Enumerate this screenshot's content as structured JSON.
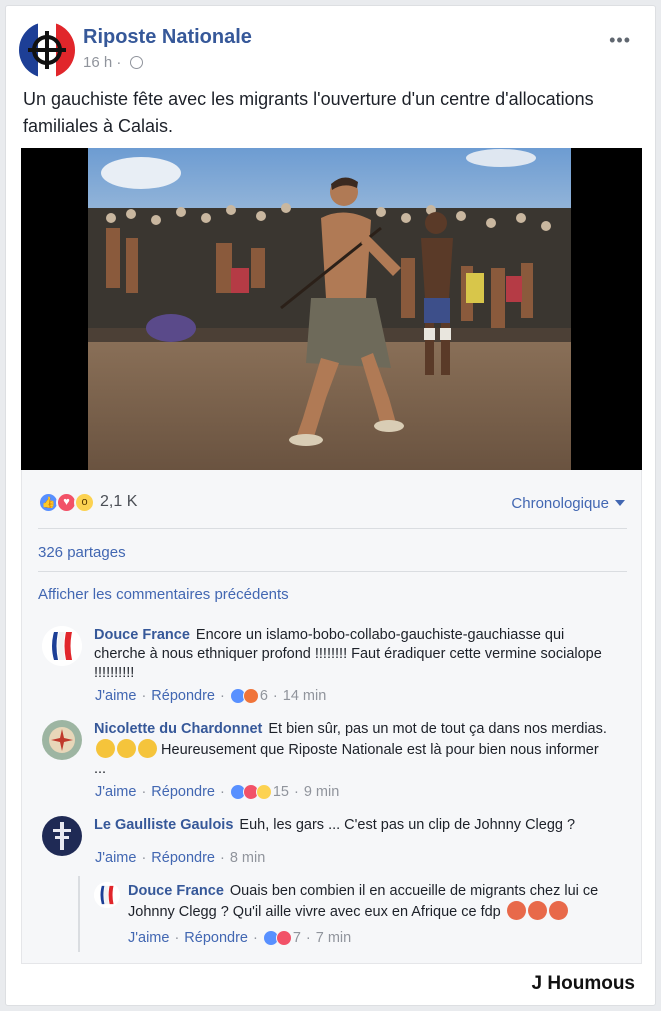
{
  "post": {
    "page_name": "Riposte Nationale",
    "time": "16 h",
    "time_separator": "·",
    "audience_icon": "globe-icon",
    "more_icon": "ellipsis-icon",
    "text": "Un gauchiste fête avec les migrants l'ouverture d'un centre d'allocations familiales à Calais."
  },
  "stats": {
    "reactions_count": "2,1 K",
    "reaction_icons": [
      "like-icon",
      "love-icon",
      "wow-icon"
    ],
    "sort_label": "Chronologique",
    "shares": "326 partages",
    "previous_comments": "Afficher les commentaires précédents"
  },
  "comments": [
    {
      "author": "Douce France",
      "text": "Encore un islamo-bobo-collabo-gauchiste-gauchiasse qui cherche à nous ethniquer profond !!!!!!!! Faut éradiquer cette vermine socialope !!!!!!!!!!",
      "like": "J'aime",
      "reply": "Répondre",
      "reactions": "6",
      "time": "14 min"
    },
    {
      "author": "Nicolette du Chardonnet",
      "text_a": "Et bien sûr, pas un mot de tout ça dans nos merdias.",
      "text_b": "Heureusement que Riposte Nationale est là pour bien nous informer ...",
      "like": "J'aime",
      "reply": "Répondre",
      "reactions": "15",
      "time": "9 min"
    },
    {
      "author": "Le Gaulliste Gaulois",
      "text": "Euh, les gars ... C'est pas un clip de Johnny Clegg ?",
      "like": "J'aime",
      "reply": "Répondre",
      "time": "8 min"
    },
    {
      "author": "Douce France",
      "text": "Ouais ben combien il en accueille de migrants chez lui ce Johnny Clegg ?  Qu'il aille vivre avec eux en Afrique ce fdp",
      "like": "J'aime",
      "reply": "Répondre",
      "reactions": "7",
      "time": "7 min"
    }
  ],
  "watermark": "J Houmous",
  "colors": {
    "link_blue": "#365899",
    "action_blue": "#4267b2",
    "grey_text": "#90949c",
    "footer_bg": "#f6f7f9"
  }
}
